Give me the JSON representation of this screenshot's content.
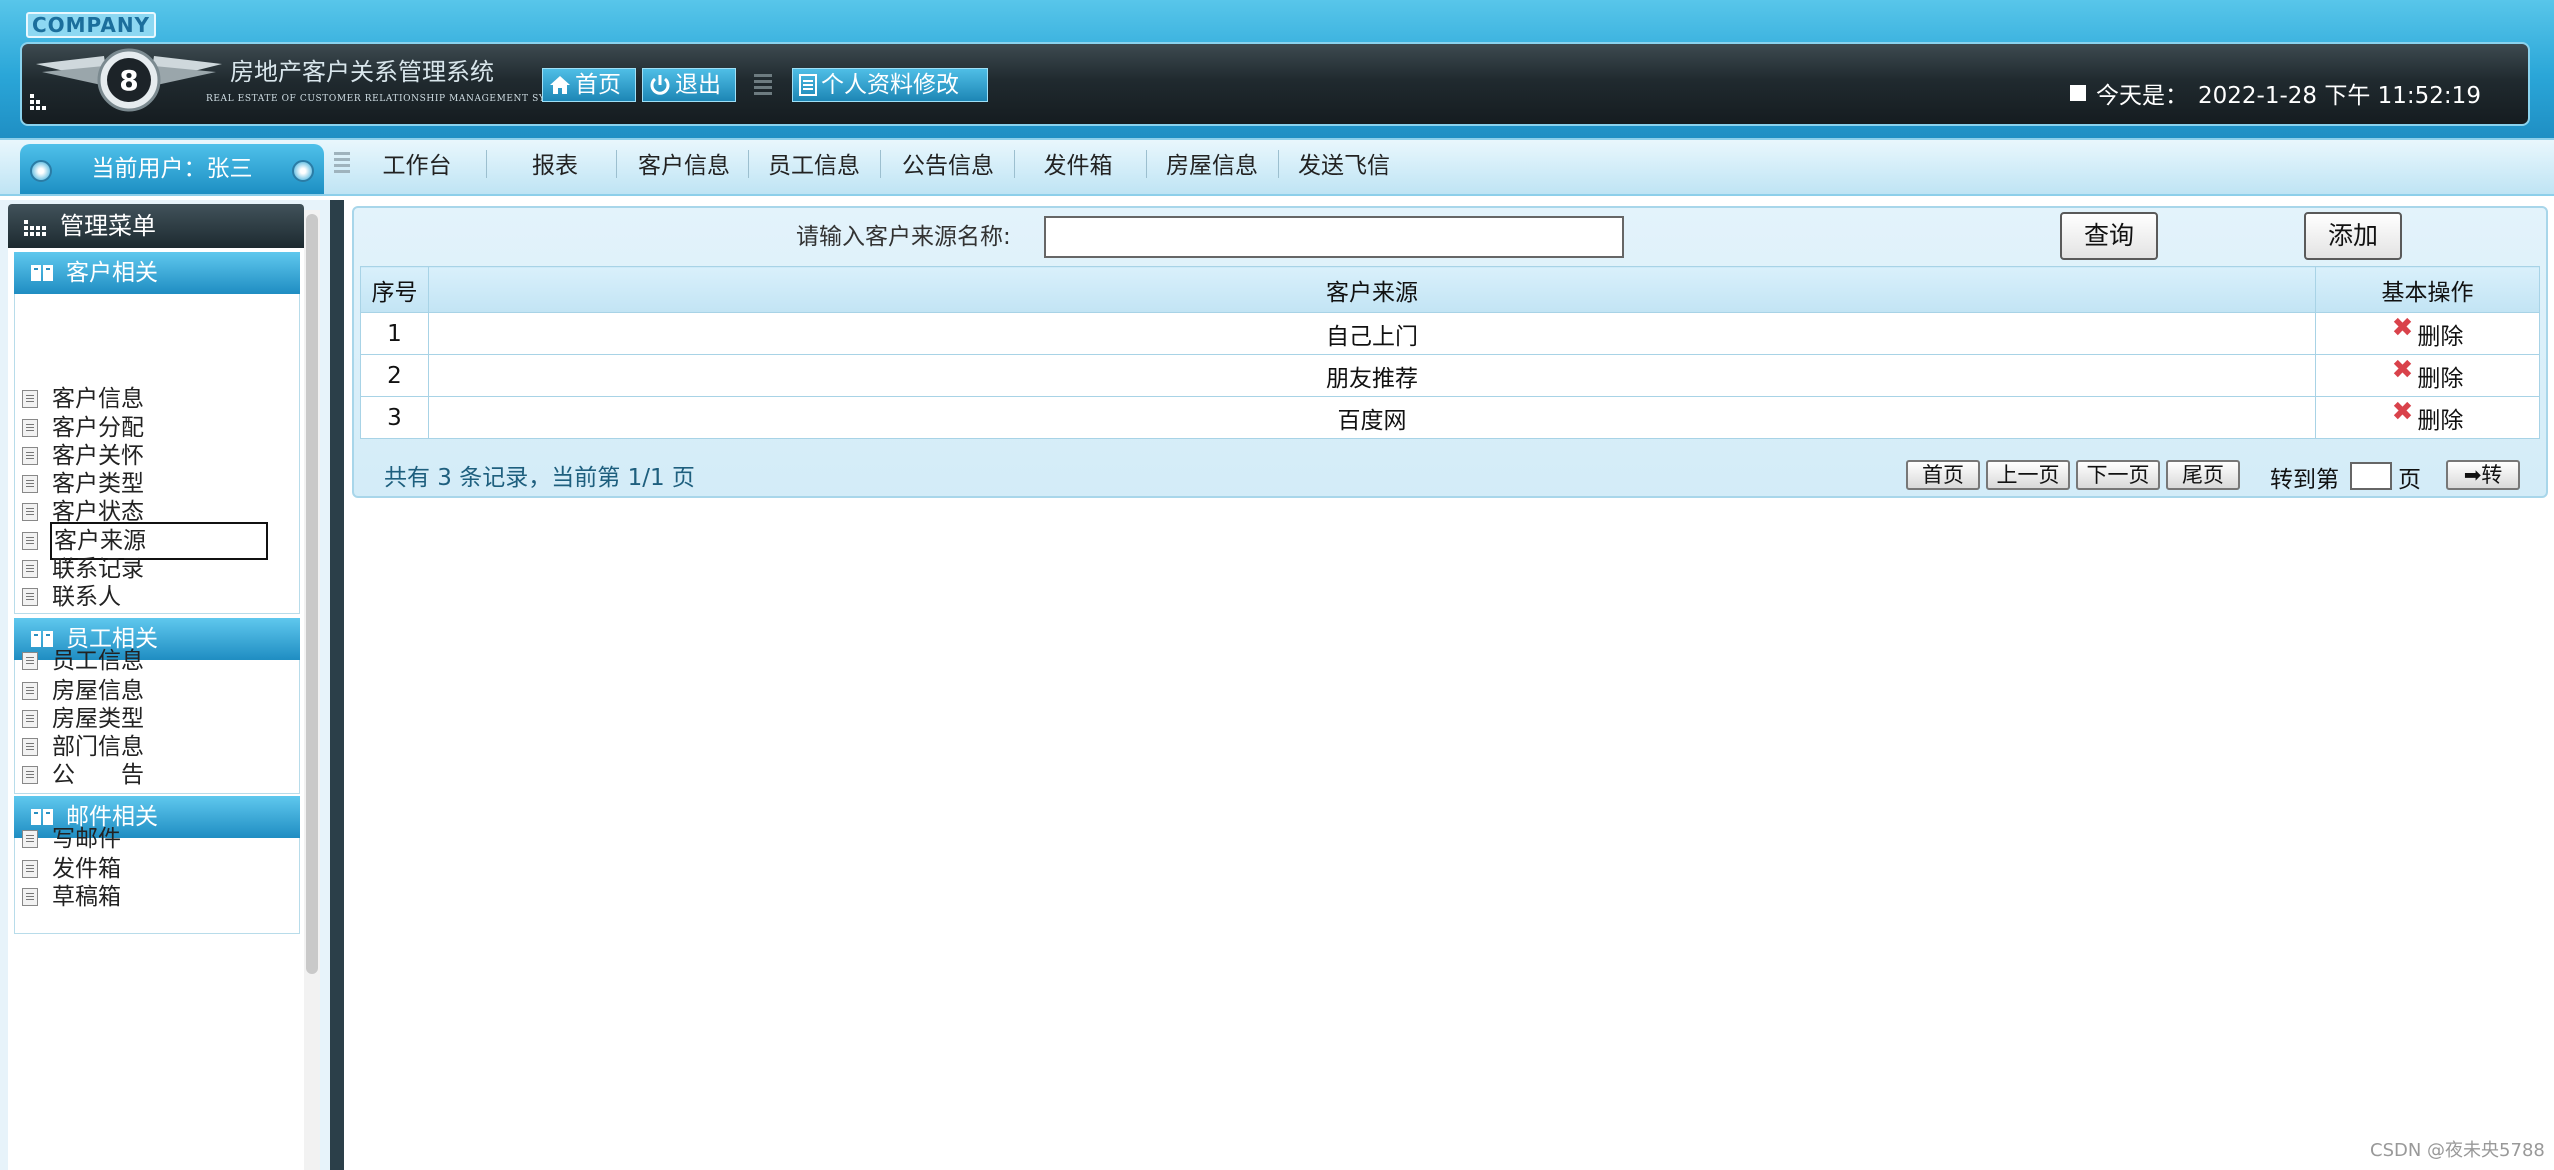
{
  "header": {
    "company": "COMPANY",
    "title": "房地产客户关系管理系统",
    "subtitle": "REAL ESTATE OF CUSTOMER RELATIONSHIP MANAGEMENT SYSTEM",
    "home_label": "首页",
    "logout_label": "退出",
    "profile_label": "个人资料修改",
    "date_prefix": "今天是：",
    "date_value": "2022-1-28 下午 11:52:19"
  },
  "nav": {
    "current_user": "当前用户：张三",
    "items": [
      "工作台",
      "报表",
      "客户信息",
      "员工信息",
      "公告信息",
      "发件箱",
      "房屋信息",
      "发送飞信"
    ]
  },
  "sidebar": {
    "menu_title": "管理菜单",
    "groups": [
      {
        "title": "客户相关",
        "items": [
          "客户信息",
          "客户分配",
          "客户关怀",
          "客户类型",
          "客户状态",
          "客户来源",
          "联系记录",
          "联系人"
        ]
      },
      {
        "title": "员工相关",
        "items": [
          "员工信息",
          "房屋信息",
          "房屋类型",
          "部门信息",
          "公　　告"
        ]
      },
      {
        "title": "邮件相关",
        "items": [
          "写邮件",
          "发件箱",
          "草稿箱"
        ]
      }
    ],
    "active_item": "客户来源"
  },
  "search": {
    "label": "请输入客户来源名称:",
    "value": "",
    "placeholder": "",
    "query_label": "查询",
    "add_label": "添加"
  },
  "table": {
    "columns": [
      "序号",
      "客户来源",
      "基本操作"
    ],
    "rows": [
      {
        "id": "1",
        "source": "自己上门",
        "action": "删除"
      },
      {
        "id": "2",
        "source": "朋友推荐",
        "action": "删除"
      },
      {
        "id": "3",
        "source": "百度网",
        "action": "删除"
      }
    ]
  },
  "pagination": {
    "summary": "共有 3 条记录，当前第 1/1 页",
    "first": "首页",
    "prev": "上一页",
    "next": "下一页",
    "last": "尾页",
    "goto_label": "转到第",
    "page_suffix": "页",
    "go": "➡转"
  },
  "watermark": "CSDN @夜未央5788",
  "colors": {
    "accent": "#2aa6d8",
    "header_dark": "#1d2a30",
    "delete_icon": "#d9424b"
  }
}
